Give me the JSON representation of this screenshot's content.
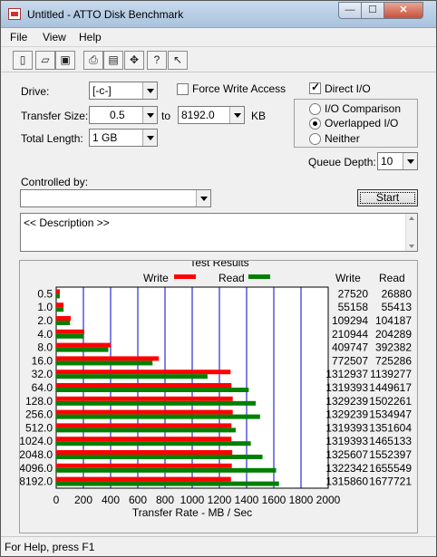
{
  "window": {
    "title": "Untitled - ATTO Disk Benchmark",
    "controls": {
      "minimize": "—",
      "maximize": "☐",
      "close": "✕"
    }
  },
  "menu": [
    "File",
    "View",
    "Help"
  ],
  "toolbar_icons": [
    "new-icon",
    "open-icon",
    "save-icon",
    "print-icon",
    "print-preview-icon",
    "move-icon",
    "help-icon",
    "context-help-icon"
  ],
  "form": {
    "drive_label": "Drive:",
    "drive_value": "[-c-]",
    "force_write_label": "Force Write Access",
    "force_write_checked": false,
    "direct_io_label": "Direct I/O",
    "direct_io_checked": true,
    "transfer_size_label": "Transfer Size:",
    "transfer_from": "0.5",
    "to_label": "to",
    "transfer_to": "8192.0",
    "kb_label": "KB",
    "total_length_label": "Total Length:",
    "total_length_value": "1 GB",
    "io_options": [
      {
        "label": "I/O Comparison",
        "selected": false
      },
      {
        "label": "Overlapped I/O",
        "selected": true
      },
      {
        "label": "Neither",
        "selected": false
      }
    ],
    "queue_depth_label": "Queue Depth:",
    "queue_depth_value": "10",
    "controlled_by_label": "Controlled by:",
    "controlled_by_value": "",
    "start_label": "Start",
    "description": "<< Description >>"
  },
  "results": {
    "title": "Test Results",
    "write_legend": "Write",
    "read_legend": "Read",
    "write_col": "Write",
    "read_col": "Read",
    "xlabel": "Transfer Rate - MB / Sec"
  },
  "chart_data": {
    "type": "bar",
    "orientation": "horizontal",
    "title": "Test Results",
    "xlabel": "Transfer Rate - MB / Sec",
    "xlim": [
      0,
      2000
    ],
    "xticks": [
      0,
      200,
      400,
      600,
      800,
      1000,
      1200,
      1400,
      1600,
      1800,
      2000
    ],
    "grid": true,
    "legend_position": "top",
    "categories": [
      "0.5",
      "1.0",
      "2.0",
      "4.0",
      "8.0",
      "16.0",
      "32.0",
      "64.0",
      "128.0",
      "256.0",
      "512.0",
      "1024.0",
      "2048.0",
      "4096.0",
      "8192.0"
    ],
    "series": [
      {
        "name": "Write",
        "color": "#ff0000",
        "values": [
          26.9,
          53.9,
          106.7,
          205.9,
          400.2,
          754.6,
          1282.2,
          1288.5,
          1298.1,
          1298.1,
          1288.5,
          1288.5,
          1294.5,
          1291.4,
          1285.0
        ],
        "labels": [
          "27520",
          "55158",
          "109294",
          "210944",
          "409747",
          "772507",
          "1312937",
          "1319393",
          "1329239",
          "1329239",
          "1319393",
          "1319393",
          "1325607",
          "1322342",
          "1315860"
        ]
      },
      {
        "name": "Read",
        "color": "#008000",
        "values": [
          26.3,
          54.1,
          101.7,
          199.5,
          383.2,
          708.3,
          1112.6,
          1415.6,
          1466.9,
          1499.0,
          1319.9,
          1430.8,
          1516.7,
          1616.8,
          1638.4
        ],
        "labels": [
          "26880",
          "55413",
          "104187",
          "204289",
          "392382",
          "725286",
          "1139277",
          "1449617",
          "1502261",
          "1534947",
          "1351604",
          "1465133",
          "1552397",
          "1655549",
          "1677721"
        ]
      }
    ]
  },
  "status": {
    "text": "For Help, press F1"
  }
}
